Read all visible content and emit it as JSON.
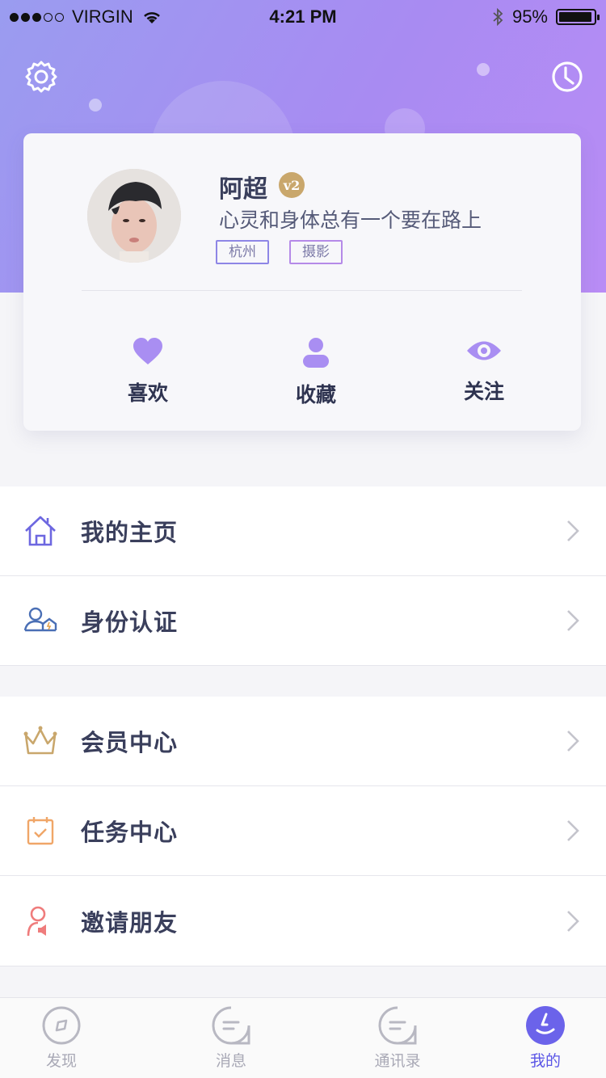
{
  "status_bar": {
    "carrier": "VIRGIN",
    "time": "4:21 PM",
    "battery": "95%",
    "battery_level": 0.95
  },
  "header": {
    "settings_icon": "gear-icon",
    "history_icon": "clock-icon",
    "gradient": [
      "#9a9cf0",
      "#b98cf5"
    ]
  },
  "profile": {
    "name": "阿超",
    "level": "v2",
    "motto": "心灵和身体总有一个要在路上",
    "tags": [
      "杭州",
      "摄影"
    ]
  },
  "stats": [
    {
      "label": "喜欢",
      "icon": "heart-icon"
    },
    {
      "label": "收藏",
      "icon": "person-icon"
    },
    {
      "label": "关注",
      "icon": "eye-icon"
    }
  ],
  "menu": {
    "group1": [
      {
        "label": "我的主页",
        "icon": "home-icon"
      },
      {
        "label": "身份认证",
        "icon": "id-verify-icon"
      }
    ],
    "group2": [
      {
        "label": "会员中心",
        "icon": "crown-icon"
      },
      {
        "label": "任务中心",
        "icon": "calendar-check-icon"
      },
      {
        "label": "邀请朋友",
        "icon": "invite-icon"
      }
    ]
  },
  "tabbar": [
    {
      "label": "发现",
      "icon": "compass-icon",
      "active": false
    },
    {
      "label": "消息",
      "icon": "message-icon",
      "active": false
    },
    {
      "label": "通讯录",
      "icon": "contacts-icon",
      "active": false
    },
    {
      "label": "我的",
      "icon": "profile-icon",
      "active": true
    }
  ],
  "colors": {
    "accent": "#5a55e6",
    "stat_icon": "#a98ef2",
    "gold": "#c9a76c"
  }
}
